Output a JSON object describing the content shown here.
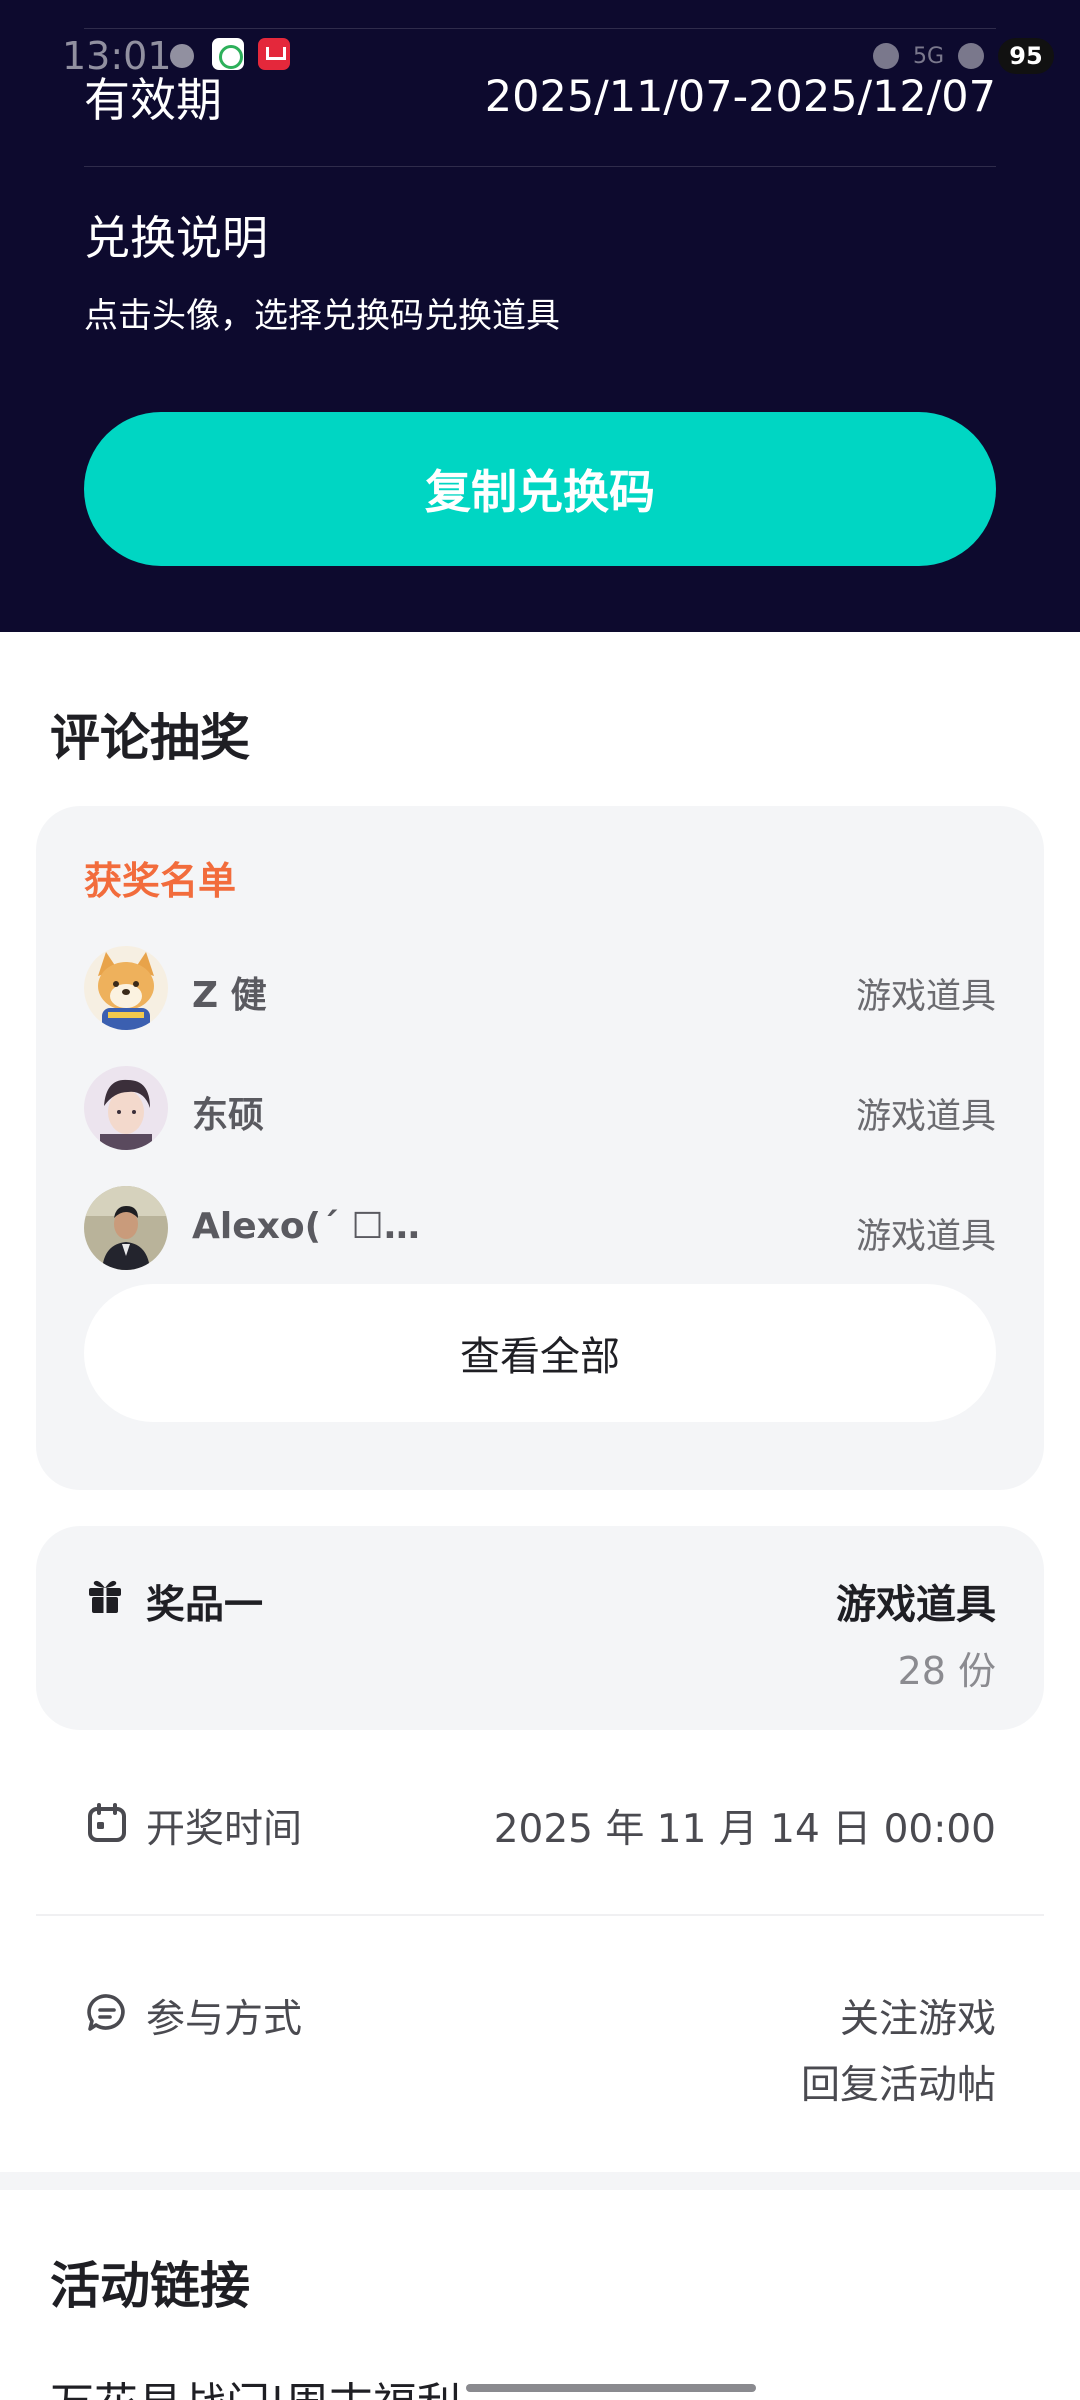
{
  "status_bar": {
    "time": "13:01",
    "network": "5G",
    "battery": "95"
  },
  "voucher": {
    "validity_label": "有效期",
    "validity_value": "2025/11/07-2025/12/07",
    "redeem_title": "兑换说明",
    "redeem_desc": "点击头像，选择兑换码兑换道具",
    "copy_button": "复制兑换码",
    "accent_color": "#00d6c3",
    "background_color": "#0d0a2e"
  },
  "lottery": {
    "title": "评论抽奖",
    "winners_title": "获奖名单",
    "winners": [
      {
        "name": "Z 健",
        "prize": "游戏道具",
        "avatar": "shiba-dog-avatar"
      },
      {
        "name": "东硕",
        "prize": "游戏道具",
        "avatar": "anime-boy-avatar"
      },
      {
        "name": "Alexo(ˊ ☐…",
        "prize": "游戏道具",
        "avatar": "person-photo-avatar"
      }
    ],
    "view_all": "查看全部",
    "prize": {
      "label": "奖品一",
      "name": "游戏道具",
      "count": "28 份",
      "icon": "gift-icon"
    },
    "draw_time": {
      "label": "开奖时间",
      "value": "2025 年 11 月 14 日 00:00",
      "icon": "calendar-icon"
    },
    "participation": {
      "label": "参与方式",
      "values": [
        "关注游戏",
        "回复活动帖"
      ],
      "icon": "comment-icon"
    },
    "winners_color": "#f26c3c"
  },
  "activity_links": {
    "title": "活动链接",
    "first_item_partial": "万花易战门|周末福利"
  }
}
